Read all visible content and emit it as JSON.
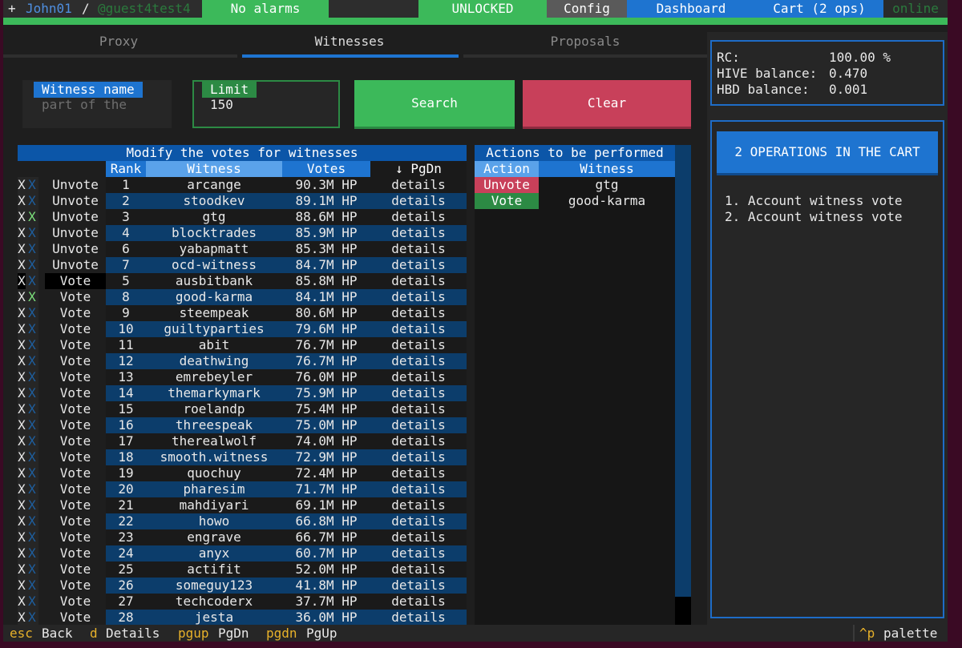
{
  "topbar": {
    "plus": "+",
    "user": "John01",
    "sep": "/",
    "guest": "@guest4test4",
    "alarms": "No alarms",
    "lock": "UNLOCKED",
    "config": "Config",
    "dashboard": "Dashboard",
    "cart": "Cart (2 ops)",
    "status": "online"
  },
  "tabs": [
    "Proxy",
    "Witnesses",
    "Proposals"
  ],
  "search": {
    "name_label": "Witness name",
    "name_placeholder": "part of the",
    "limit_label": "Limit",
    "limit_value": "150",
    "search_button": "Search",
    "clear_button": "Clear"
  },
  "witness_table": {
    "title": "Modify the votes for witnesses",
    "headers": [
      "Rank",
      "Witness",
      "Votes",
      "↓ PgDn"
    ],
    "rows": [
      {
        "mark": "X",
        "action": "Unvote",
        "rank": "1",
        "witness": "arcange",
        "votes": "90.3M HP",
        "details": "details"
      },
      {
        "mark": "X",
        "action": "Unvote",
        "rank": "2",
        "witness": "stoodkev",
        "votes": "89.1M HP",
        "details": "details"
      },
      {
        "mark": "X",
        "action": "Unvote",
        "rank": "3",
        "witness": "gtg",
        "votes": "88.6M HP",
        "details": "details",
        "mark_active": true
      },
      {
        "mark": "X",
        "action": "Unvote",
        "rank": "4",
        "witness": "blocktrades",
        "votes": "85.9M HP",
        "details": "details"
      },
      {
        "mark": "X",
        "action": "Unvote",
        "rank": "6",
        "witness": "yabapmatt",
        "votes": "85.3M HP",
        "details": "details"
      },
      {
        "mark": "X",
        "action": "Unvote",
        "rank": "7",
        "witness": "ocd-witness",
        "votes": "84.7M HP",
        "details": "details"
      },
      {
        "mark": "X",
        "action": "Vote",
        "rank": "5",
        "witness": "ausbitbank",
        "votes": "85.8M HP",
        "details": "details",
        "focused": true
      },
      {
        "mark": "X",
        "action": "Vote",
        "rank": "8",
        "witness": "good-karma",
        "votes": "84.1M HP",
        "details": "details",
        "mark_active": true
      },
      {
        "mark": "X",
        "action": "Vote",
        "rank": "9",
        "witness": "steempeak",
        "votes": "80.6M HP",
        "details": "details"
      },
      {
        "mark": "X",
        "action": "Vote",
        "rank": "10",
        "witness": "guiltyparties",
        "votes": "79.6M HP",
        "details": "details"
      },
      {
        "mark": "X",
        "action": "Vote",
        "rank": "11",
        "witness": "abit",
        "votes": "76.7M HP",
        "details": "details"
      },
      {
        "mark": "X",
        "action": "Vote",
        "rank": "12",
        "witness": "deathwing",
        "votes": "76.7M HP",
        "details": "details"
      },
      {
        "mark": "X",
        "action": "Vote",
        "rank": "13",
        "witness": "emrebeyler",
        "votes": "76.0M HP",
        "details": "details"
      },
      {
        "mark": "X",
        "action": "Vote",
        "rank": "14",
        "witness": "themarkymark",
        "votes": "75.9M HP",
        "details": "details"
      },
      {
        "mark": "X",
        "action": "Vote",
        "rank": "15",
        "witness": "roelandp",
        "votes": "75.4M HP",
        "details": "details"
      },
      {
        "mark": "X",
        "action": "Vote",
        "rank": "16",
        "witness": "threespeak",
        "votes": "75.0M HP",
        "details": "details"
      },
      {
        "mark": "X",
        "action": "Vote",
        "rank": "17",
        "witness": "therealwolf",
        "votes": "74.0M HP",
        "details": "details"
      },
      {
        "mark": "X",
        "action": "Vote",
        "rank": "18",
        "witness": "smooth.witness",
        "votes": "72.9M HP",
        "details": "details"
      },
      {
        "mark": "X",
        "action": "Vote",
        "rank": "19",
        "witness": "quochuy",
        "votes": "72.4M HP",
        "details": "details"
      },
      {
        "mark": "X",
        "action": "Vote",
        "rank": "20",
        "witness": "pharesim",
        "votes": "71.7M HP",
        "details": "details"
      },
      {
        "mark": "X",
        "action": "Vote",
        "rank": "21",
        "witness": "mahdiyari",
        "votes": "69.1M HP",
        "details": "details"
      },
      {
        "mark": "X",
        "action": "Vote",
        "rank": "22",
        "witness": "howo",
        "votes": "66.8M HP",
        "details": "details"
      },
      {
        "mark": "X",
        "action": "Vote",
        "rank": "23",
        "witness": "engrave",
        "votes": "66.7M HP",
        "details": "details"
      },
      {
        "mark": "X",
        "action": "Vote",
        "rank": "24",
        "witness": "anyx",
        "votes": "60.7M HP",
        "details": "details"
      },
      {
        "mark": "X",
        "action": "Vote",
        "rank": "25",
        "witness": "actifit",
        "votes": "52.0M HP",
        "details": "details"
      },
      {
        "mark": "X",
        "action": "Vote",
        "rank": "26",
        "witness": "someguy123",
        "votes": "41.8M HP",
        "details": "details"
      },
      {
        "mark": "X",
        "action": "Vote",
        "rank": "27",
        "witness": "techcoderx",
        "votes": "37.7M HP",
        "details": "details"
      },
      {
        "mark": "X",
        "action": "Vote",
        "rank": "28",
        "witness": "jesta",
        "votes": "36.0M HP",
        "details": "details"
      }
    ]
  },
  "actions_table": {
    "title": "Actions to be performed",
    "headers": [
      "Action",
      "Witness"
    ],
    "rows": [
      {
        "action": "Unvote",
        "witness": "gtg"
      },
      {
        "action": "Vote",
        "witness": "good-karma"
      }
    ]
  },
  "account": {
    "rc_label": "RC:",
    "rc_value": "100.00 %",
    "hive_label": "HIVE balance:",
    "hive_value": "0.470",
    "hbd_label": "HBD balance:",
    "hbd_value": "0.001"
  },
  "cart": {
    "header": "2 OPERATIONS IN THE CART",
    "items": [
      "1. Account witness vote",
      "2. Account witness vote"
    ]
  },
  "bottombar": {
    "keys": [
      {
        "key": "esc",
        "label": "Back"
      },
      {
        "key": "d",
        "label": "Details"
      },
      {
        "key": "pgup",
        "label": "PgDn"
      },
      {
        "key": "pgdn",
        "label": "PgUp"
      }
    ],
    "palette_key": "^p",
    "palette_label": "palette"
  },
  "colors": {
    "accent_blue": "#1e74d0",
    "green": "#3cb95a",
    "red": "#c8405a",
    "row_blue": "#0c3d6b",
    "key_yellow": "#e7b12a"
  }
}
